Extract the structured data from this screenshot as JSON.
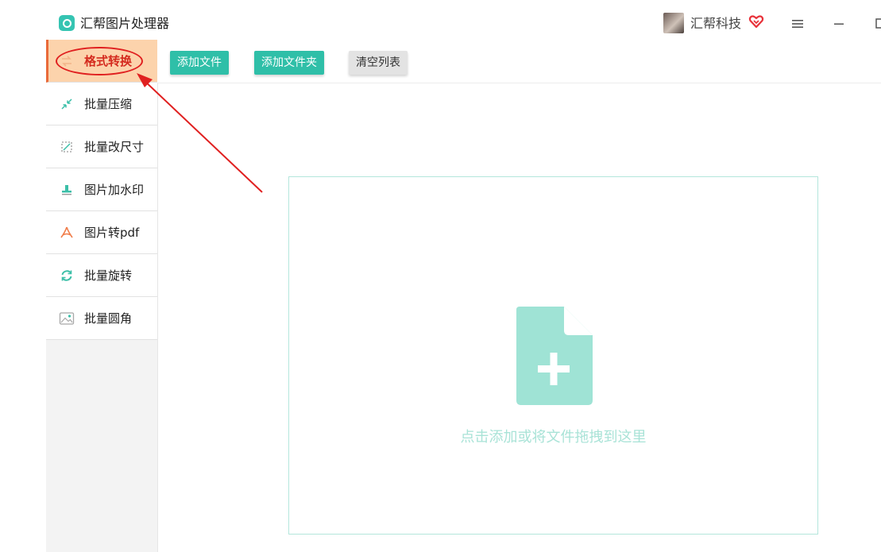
{
  "app": {
    "title": "汇帮图片处理器"
  },
  "user": {
    "name": "汇帮科技"
  },
  "icons": {
    "app_logo": "app-logo-icon",
    "vip": "vip-heart-icon",
    "menu": "menu-icon",
    "minimize": "minimize-icon",
    "maximize": "maximize-icon",
    "add_file": "file-plus-icon"
  },
  "sidebar": {
    "items": [
      {
        "label": "格式转换",
        "icon": "convert-icon",
        "active": true
      },
      {
        "label": "批量压缩",
        "icon": "compress-icon",
        "active": false
      },
      {
        "label": "批量改尺寸",
        "icon": "resize-icon",
        "active": false
      },
      {
        "label": "图片加水印",
        "icon": "watermark-icon",
        "active": false
      },
      {
        "label": "图片转pdf",
        "icon": "pdf-icon",
        "active": false
      },
      {
        "label": "批量旋转",
        "icon": "rotate-icon",
        "active": false
      },
      {
        "label": "批量圆角",
        "icon": "round-corner-icon",
        "active": false
      }
    ]
  },
  "toolbar": {
    "add_file_label": "添加文件",
    "add_folder_label": "添加文件夹",
    "clear_list_label": "清空列表"
  },
  "dropzone": {
    "hint": "点击添加或将文件拖拽到这里"
  },
  "colors": {
    "accent": "#2fbfa8",
    "active_bg": "#fcd3ac",
    "annotation_red": "#e02020",
    "drop_icon": "#9fe3d5"
  }
}
